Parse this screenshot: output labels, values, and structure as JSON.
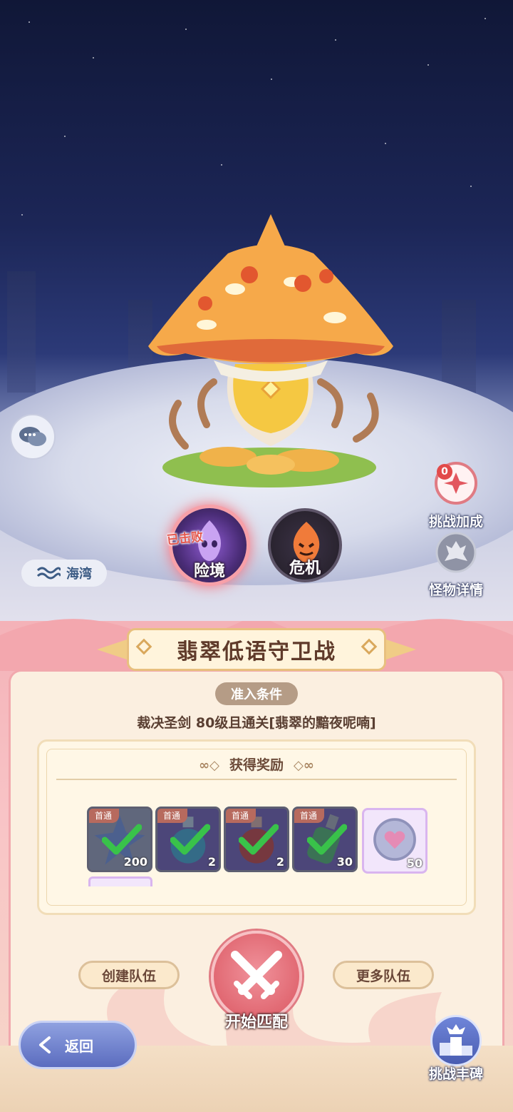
{
  "boss": {
    "name": "翡翠低语守卫战"
  },
  "difficulties": [
    {
      "label": "险境",
      "status": "已击败",
      "selected": true,
      "color": "#7b4fc0"
    },
    {
      "label": "危机",
      "status": "",
      "selected": false,
      "color": "#e05b2c"
    }
  ],
  "side": {
    "challenge_bonus": {
      "label": "挑战加成",
      "count": "0"
    },
    "monster_detail": {
      "label": "怪物详情"
    },
    "region": {
      "label": "海湾"
    }
  },
  "entry": {
    "tag": "准入条件",
    "requirement": "裁决圣剑  80级且通关[翡翠的黯夜呢喃]"
  },
  "rewards": {
    "title": "获得奖励",
    "items": [
      {
        "icon": "crystal-star-icon",
        "badge": "首通",
        "qty": "200",
        "claimed": true
      },
      {
        "icon": "blue-potion-icon",
        "badge": "首通",
        "qty": "2",
        "claimed": true
      },
      {
        "icon": "red-potion-icon",
        "badge": "首通",
        "qty": "2",
        "claimed": true
      },
      {
        "icon": "green-bottle-icon",
        "badge": "首通",
        "qty": "30",
        "claimed": true
      },
      {
        "icon": "heart-coin-icon",
        "badge": "",
        "qty": "50",
        "claimed": false
      }
    ]
  },
  "buttons": {
    "create_team": "创建队伍",
    "more_teams": "更多队伍",
    "start_match": "开始匹配",
    "back": "返回",
    "trophy": "挑战丰碑"
  },
  "colors": {
    "accent": "#e16872",
    "panel": "#fbefe0",
    "back": "#5b6cbf"
  }
}
